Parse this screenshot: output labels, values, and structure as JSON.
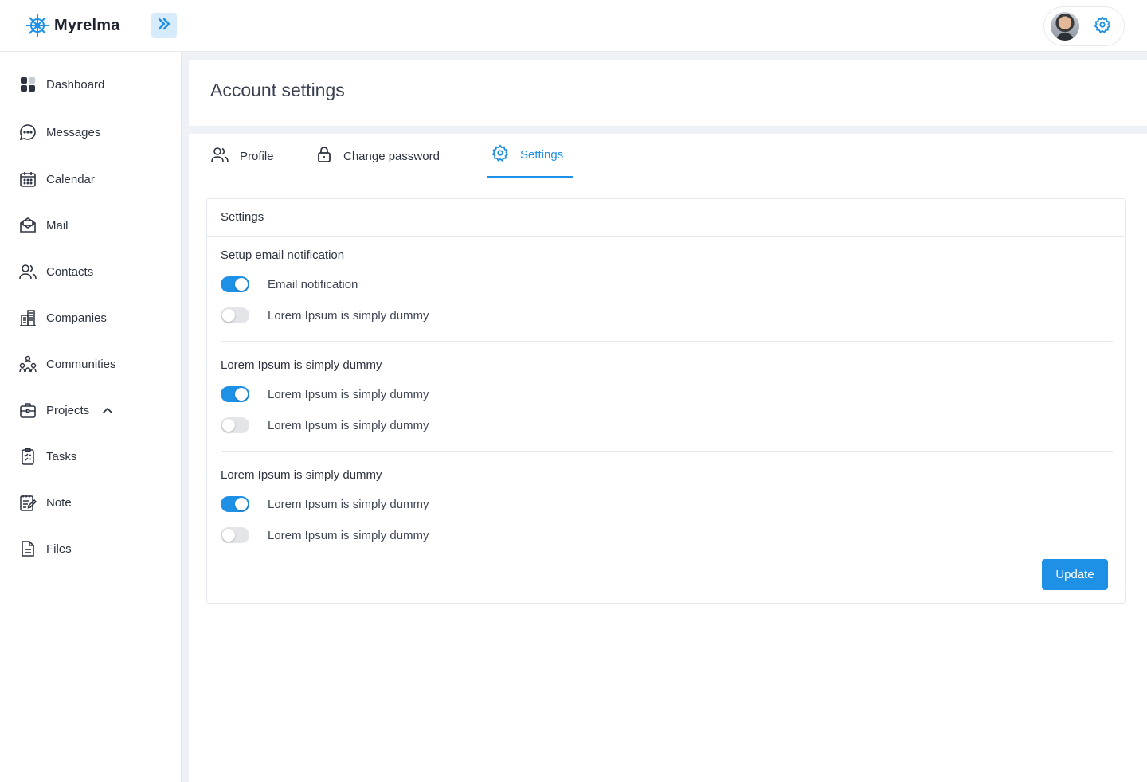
{
  "app": {
    "name": "Myrelma",
    "accent_color": "#1e90e6",
    "logo_icon": "ship-wheel-icon"
  },
  "topbar": {
    "collapse_icon": "double-chevron-right-icon",
    "avatar_alt": "user-avatar",
    "settings_icon": "gear-icon"
  },
  "sidebar": {
    "items": [
      {
        "label": "Dashboard",
        "icon": "dashboard-icon"
      },
      {
        "label": "Messages",
        "icon": "chat-bubble-icon"
      },
      {
        "label": "Calendar",
        "icon": "calendar-icon"
      },
      {
        "label": "Mail",
        "icon": "mail-icon"
      },
      {
        "label": "Contacts",
        "icon": "contacts-icon"
      },
      {
        "label": "Companies",
        "icon": "building-icon"
      },
      {
        "label": "Communities",
        "icon": "community-icon"
      },
      {
        "label": "Projects",
        "icon": "briefcase-icon",
        "expanded": true
      },
      {
        "label": "Tasks",
        "icon": "clipboard-icon"
      },
      {
        "label": "Note",
        "icon": "note-icon"
      },
      {
        "label": "Files",
        "icon": "file-icon"
      }
    ]
  },
  "page": {
    "title": "Account settings"
  },
  "tabs": [
    {
      "label": "Profile",
      "icon": "users-icon",
      "active": false
    },
    {
      "label": "Change password",
      "icon": "lock-icon",
      "active": false
    },
    {
      "label": "Settings",
      "icon": "gear-icon",
      "active": true
    }
  ],
  "settings": {
    "title": "Settings",
    "groups": [
      {
        "title": "Setup email notification",
        "options": [
          {
            "label": "Email notification",
            "enabled": true
          },
          {
            "label": "Lorem Ipsum is simply dummy",
            "enabled": false
          }
        ]
      },
      {
        "title": "Lorem Ipsum is simply dummy",
        "options": [
          {
            "label": "Lorem Ipsum is simply dummy",
            "enabled": true
          },
          {
            "label": "Lorem Ipsum is simply dummy",
            "enabled": false
          }
        ]
      },
      {
        "title": "Lorem Ipsum is simply dummy",
        "options": [
          {
            "label": "Lorem Ipsum is simply dummy",
            "enabled": true
          },
          {
            "label": "Lorem Ipsum is simply dummy",
            "enabled": false
          }
        ]
      }
    ],
    "update_label": "Update"
  }
}
